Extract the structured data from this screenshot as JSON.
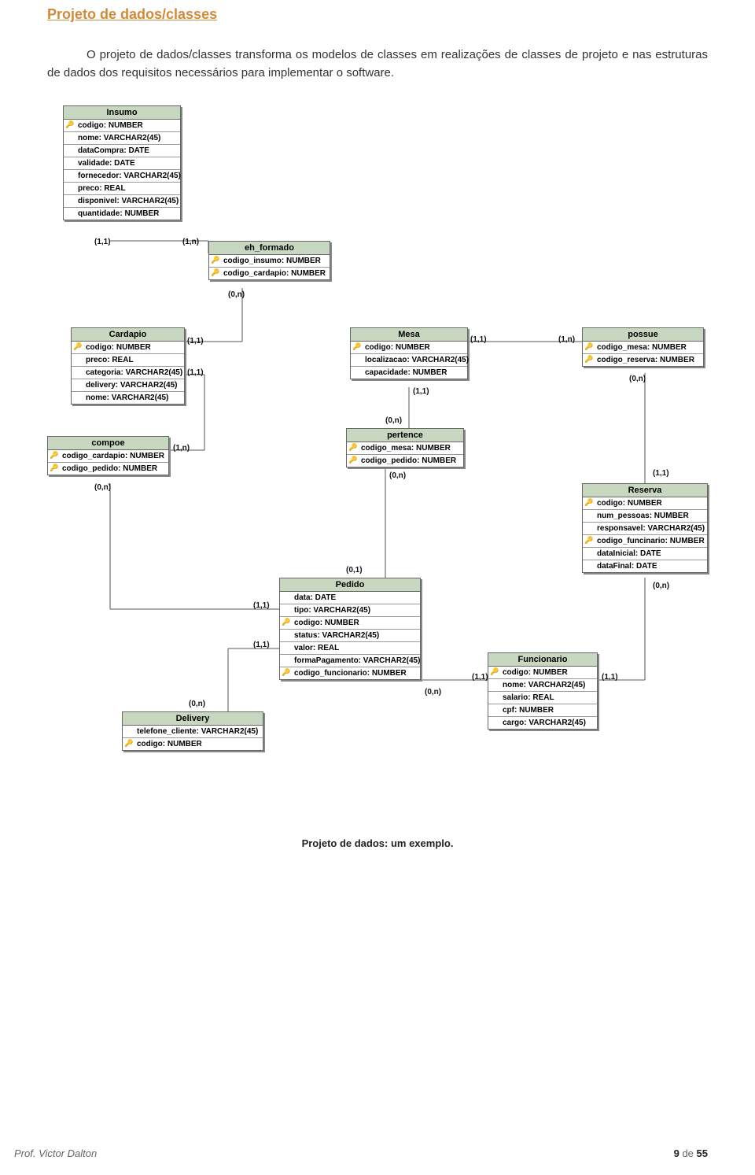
{
  "title": "Projeto de dados/classes",
  "paragraph": "O projeto de dados/classes transforma os modelos de classes em realizações de classes de projeto e nas estruturas de dados dos requisitos necessários para implementar o software.",
  "caption": "Projeto de dados: um exemplo.",
  "footer": {
    "author": "Prof. Victor Dalton",
    "page_current": "9",
    "page_sep": "de",
    "page_total": "55"
  },
  "entities": {
    "insumo": {
      "name": "Insumo",
      "rows": [
        {
          "k": true,
          "t": "codigo: NUMBER"
        },
        {
          "k": false,
          "t": "nome: VARCHAR2(45)"
        },
        {
          "k": false,
          "t": "dataCompra: DATE"
        },
        {
          "k": false,
          "t": "validade: DATE"
        },
        {
          "k": false,
          "t": "fornecedor: VARCHAR2(45)"
        },
        {
          "k": false,
          "t": "preco: REAL"
        },
        {
          "k": false,
          "t": "disponivel: VARCHAR2(45)"
        },
        {
          "k": false,
          "t": "quantidade: NUMBER"
        }
      ]
    },
    "eh_formado": {
      "name": "eh_formado",
      "rows": [
        {
          "k": true,
          "t": "codigo_insumo: NUMBER"
        },
        {
          "k": true,
          "t": "codigo_cardapio: NUMBER"
        }
      ]
    },
    "cardapio": {
      "name": "Cardapio",
      "rows": [
        {
          "k": true,
          "t": "codigo: NUMBER"
        },
        {
          "k": false,
          "t": "preco: REAL"
        },
        {
          "k": false,
          "t": "categoria: VARCHAR2(45)"
        },
        {
          "k": false,
          "t": "delivery: VARCHAR2(45)"
        },
        {
          "k": false,
          "t": "nome: VARCHAR2(45)"
        }
      ]
    },
    "mesa": {
      "name": "Mesa",
      "rows": [
        {
          "k": true,
          "t": "codigo: NUMBER"
        },
        {
          "k": false,
          "t": "localizacao: VARCHAR2(45)"
        },
        {
          "k": false,
          "t": "capacidade: NUMBER"
        }
      ]
    },
    "possue": {
      "name": "possue",
      "rows": [
        {
          "k": true,
          "t": "codigo_mesa: NUMBER"
        },
        {
          "k": true,
          "t": "codigo_reserva: NUMBER"
        }
      ]
    },
    "pertence": {
      "name": "pertence",
      "rows": [
        {
          "k": true,
          "t": "codigo_mesa: NUMBER"
        },
        {
          "k": true,
          "t": "codigo_pedido: NUMBER"
        }
      ]
    },
    "compoe": {
      "name": "compoe",
      "rows": [
        {
          "k": true,
          "t": "codigo_cardapio: NUMBER"
        },
        {
          "k": true,
          "t": "codigo_pedido: NUMBER"
        }
      ]
    },
    "reserva": {
      "name": "Reserva",
      "rows": [
        {
          "k": true,
          "t": "codigo: NUMBER"
        },
        {
          "k": false,
          "t": "num_pessoas: NUMBER"
        },
        {
          "k": false,
          "t": "responsavel: VARCHAR2(45)"
        },
        {
          "k": true,
          "t": "codigo_funcinario: NUMBER"
        },
        {
          "k": false,
          "t": "dataInicial: DATE"
        },
        {
          "k": false,
          "t": "dataFinal: DATE"
        }
      ]
    },
    "pedido": {
      "name": "Pedido",
      "rows": [
        {
          "k": false,
          "t": "data: DATE"
        },
        {
          "k": false,
          "t": "tipo: VARCHAR2(45)"
        },
        {
          "k": true,
          "t": "codigo: NUMBER"
        },
        {
          "k": false,
          "t": "status: VARCHAR2(45)"
        },
        {
          "k": false,
          "t": "valor: REAL"
        },
        {
          "k": false,
          "t": "formaPagamento: VARCHAR2(45)"
        },
        {
          "k": true,
          "t": "codigo_funcionario: NUMBER"
        }
      ]
    },
    "delivery": {
      "name": "Delivery",
      "rows": [
        {
          "k": false,
          "t": "telefone_cliente: VARCHAR2(45)"
        },
        {
          "k": true,
          "t": "codigo: NUMBER"
        }
      ]
    },
    "funcionario": {
      "name": "Funcionario",
      "rows": [
        {
          "k": true,
          "t": "codigo: NUMBER"
        },
        {
          "k": false,
          "t": "nome: VARCHAR2(45)"
        },
        {
          "k": false,
          "t": "salario: REAL"
        },
        {
          "k": false,
          "t": "cpf: NUMBER"
        },
        {
          "k": false,
          "t": "cargo: VARCHAR2(45)"
        }
      ]
    }
  },
  "cards": {
    "c11a": "(1,1)",
    "c1na": "(1,n)",
    "c0n": "(0,n)",
    "c01": "(0,1)"
  }
}
